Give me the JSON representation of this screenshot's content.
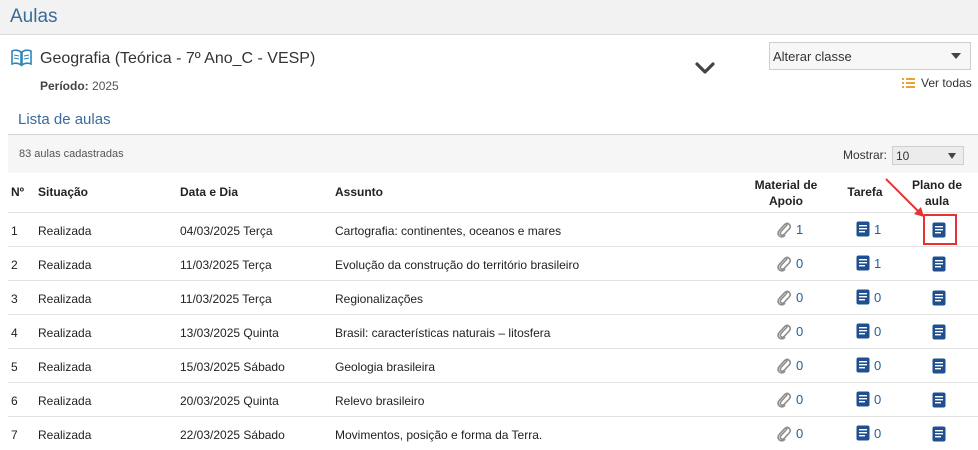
{
  "header": {
    "title": "Aulas"
  },
  "class_info": {
    "title": "Geografia (Teórica - 7º Ano_C - VESP)",
    "periodo_label": "Período:",
    "periodo_value": "2025"
  },
  "class_select": {
    "value": "Alterar classe"
  },
  "ver_todas": "Ver todas",
  "lista": {
    "title": "Lista de aulas",
    "count": "83 aulas cadastradas",
    "mostrar_label": "Mostrar:",
    "mostrar_value": "10"
  },
  "table": {
    "headers": {
      "num": "Nº",
      "situacao": "Situação",
      "data": "Data e Dia",
      "assunto": "Assunto",
      "material_1": "Material de",
      "material_2": "Apoio",
      "tarefa": "Tarefa",
      "plano_1": "Plano de",
      "plano_2": "aula"
    },
    "rows": [
      {
        "num": "1",
        "situacao": "Realizada",
        "data": "04/03/2025 Terça",
        "assunto": "Cartografia: continentes, oceanos e mares",
        "material": "1",
        "tarefa": "1"
      },
      {
        "num": "2",
        "situacao": "Realizada",
        "data": "11/03/2025 Terça",
        "assunto": "Evolução da construção do território brasileiro",
        "material": "0",
        "tarefa": "1"
      },
      {
        "num": "3",
        "situacao": "Realizada",
        "data": "11/03/2025 Terça",
        "assunto": "Regionalizações",
        "material": "0",
        "tarefa": "0"
      },
      {
        "num": "4",
        "situacao": "Realizada",
        "data": "13/03/2025 Quinta",
        "assunto": "Brasil: características naturais – litosfera",
        "material": "0",
        "tarefa": "0"
      },
      {
        "num": "5",
        "situacao": "Realizada",
        "data": "15/03/2025 Sábado",
        "assunto": "Geologia brasileira",
        "material": "0",
        "tarefa": "0"
      },
      {
        "num": "6",
        "situacao": "Realizada",
        "data": "20/03/2025 Quinta",
        "assunto": "Relevo brasileiro",
        "material": "0",
        "tarefa": "0"
      },
      {
        "num": "7",
        "situacao": "Realizada",
        "data": "22/03/2025 Sábado",
        "assunto": "Movimentos, posição e forma da Terra.",
        "material": "0",
        "tarefa": "0"
      }
    ]
  },
  "colors": {
    "accent": "#3a6a9c",
    "link": "#1e5f9e",
    "icon_doc": "#1f4f8f",
    "highlight": "#e53333",
    "list_icon": "#e8a23a"
  }
}
